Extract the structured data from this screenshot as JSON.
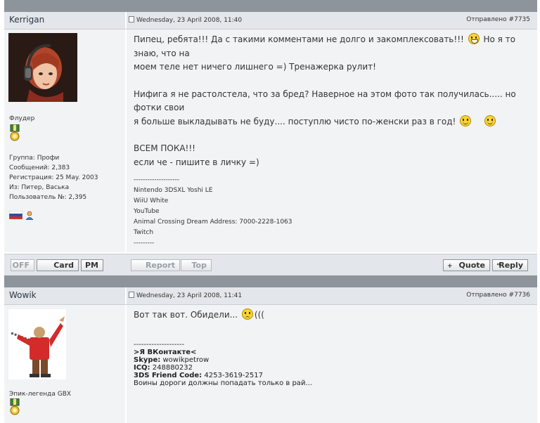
{
  "posts": [
    {
      "author": "Kerrigan",
      "date": "Wednesday, 23 April 2008, 11:40",
      "post_number": "Отправлено #7735",
      "rank": "Флудер",
      "info": {
        "group": "Группа: Профи",
        "messages": "Сообщений: 2,383",
        "registration": "Регистрация: 25 May. 2003",
        "from": "Из: Питер, Васька",
        "user_no": "Пользователь №: 2,395"
      },
      "message": {
        "line1": "Пипец, ребята!!! Да с такими комментами не долго и закомплексовать!!!",
        "line1b": "Но я то знаю, что на",
        "line2": "моем теле нет ничего лишнего =) Тренажерка рулит!",
        "line3": "Нифига я не растолстела, что за бред? Наверное на этом фото так получилась..... но фотки свои",
        "line4": "я больше выкладывать не буду.... поступлю чисто по-женски раз в год!",
        "line5": "ВСЕМ ПОКА!!!",
        "line6": "если че - пишите в личку =)"
      },
      "signature": [
        "--------------------",
        "Nintendo 3DSXL Yoshi LE",
        "WiiU White",
        "YouTube",
        "Animal Crossing Dream Address: 7000-2228-1063",
        "Twitch",
        "---------"
      ],
      "buttons": {
        "off": "OFF",
        "card": "Card",
        "pm": "PM",
        "report": "Report",
        "top": "Top",
        "quote": "Quote",
        "reply": "Reply"
      }
    },
    {
      "author": "Wowik",
      "date": "Wednesday, 23 April 2008, 11:41",
      "post_number": "Отправлено #7736",
      "rank": "Эпик-легенда GBX",
      "message": {
        "line1": "Вот так вот. Обидели...",
        "line1b": "((("
      },
      "signature": {
        "dashes": "--------------------",
        "vk": ">Я ВКонтакте<",
        "skype_label": "Skype:",
        "skype_value": "wowikpetrow",
        "icq_label": "ICQ:",
        "icq_value": "248880232",
        "fc_label": "3DS Friend Code:",
        "fc_value": "4253-3619-2517",
        "motto": "Воины дороги должны попадать только в рай..."
      }
    }
  ]
}
